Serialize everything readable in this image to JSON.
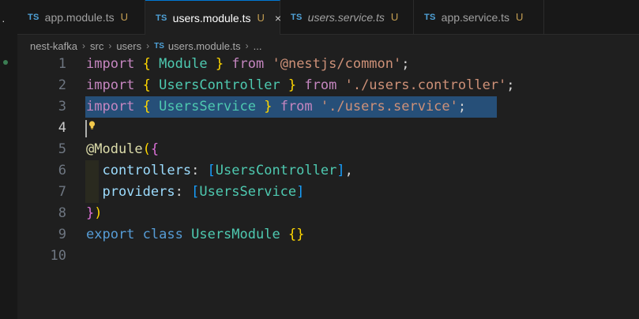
{
  "tabs": [
    {
      "lang": "TS",
      "name": "app.module.ts",
      "status": "U",
      "italic": false,
      "active": false
    },
    {
      "lang": "TS",
      "name": "users.module.ts",
      "status": "U",
      "italic": false,
      "active": true,
      "close": "×"
    },
    {
      "lang": "TS",
      "name": "users.service.ts",
      "status": "U",
      "italic": true,
      "active": false
    },
    {
      "lang": "TS",
      "name": "app.service.ts",
      "status": "U",
      "italic": false,
      "active": false
    }
  ],
  "breadcrumb": {
    "parts": [
      "nest-kafka",
      "src",
      "users",
      "users.module.ts",
      "..."
    ],
    "lang": "TS"
  },
  "left_strip": {
    "marker": "·"
  },
  "editor": {
    "current_line": 4,
    "lines": [
      {
        "n": "1"
      },
      {
        "n": "2"
      },
      {
        "n": "3"
      },
      {
        "n": "4"
      },
      {
        "n": "5"
      },
      {
        "n": "6"
      },
      {
        "n": "7"
      },
      {
        "n": "8"
      },
      {
        "n": "9"
      },
      {
        "n": "10"
      }
    ],
    "code": {
      "l1": [
        "import",
        " ",
        "{",
        " Module ",
        "}",
        " from ",
        "'@nestjs/common'",
        ";"
      ],
      "l2": [
        "import",
        " ",
        "{",
        " UsersController ",
        "}",
        " from ",
        "'./users.controller'",
        ";"
      ],
      "l3": [
        "import",
        " ",
        "{",
        " UsersService ",
        "}",
        " from ",
        "'./users.service'",
        ";"
      ],
      "l5": [
        "@Module",
        "(",
        "{"
      ],
      "l6": [
        "  controllers",
        ": ",
        "[",
        "UsersController",
        "]",
        ","
      ],
      "l7": [
        "  providers",
        ": ",
        "[",
        "UsersService",
        "]"
      ],
      "l8": [
        "}",
        ")"
      ],
      "l9": [
        "export",
        " ",
        "class",
        " ",
        "UsersModule",
        " ",
        "{}"
      ]
    }
  },
  "colors": {
    "keyword": "#c586c0",
    "storage": "#569cd6",
    "type": "#4ec9b0",
    "property": "#9cdcfe",
    "string": "#ce9178",
    "selection": "#264f78",
    "tab_active_border": "#0078d4",
    "untracked": "#c59f52"
  }
}
